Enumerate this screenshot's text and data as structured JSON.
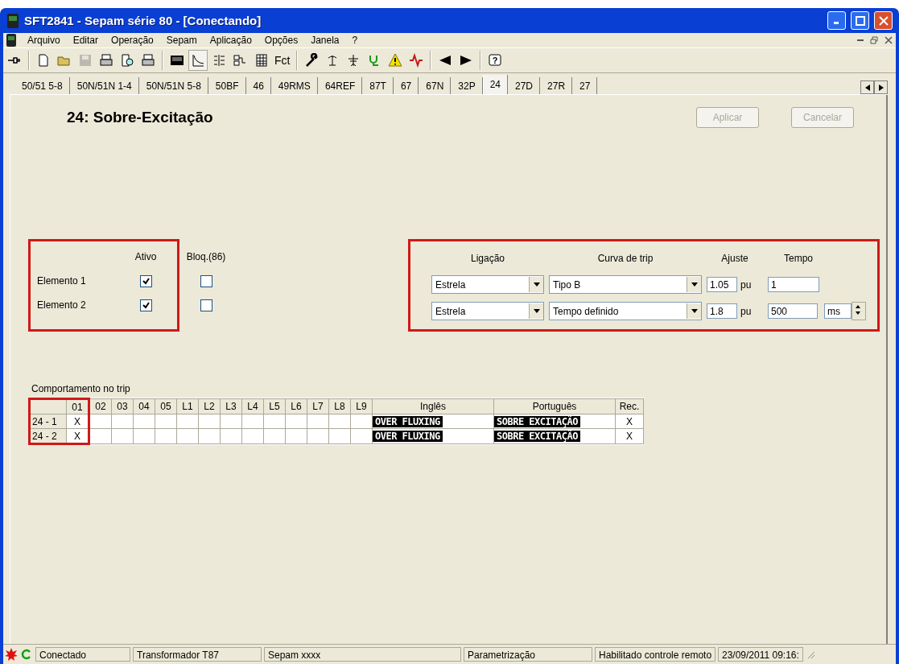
{
  "window": {
    "title": "SFT2841 - Sepam série 80 - [Conectando]"
  },
  "menu": [
    "Arquivo",
    "Editar",
    "Operação",
    "Sepam",
    "Aplicação",
    "Opções",
    "Janela",
    "?"
  ],
  "toolbar": [
    {
      "kind": "plug",
      "disabled": false,
      "selected": false
    },
    {
      "kind": "sep"
    },
    {
      "kind": "new",
      "disabled": false,
      "selected": false
    },
    {
      "kind": "open",
      "disabled": false,
      "selected": false
    },
    {
      "kind": "save",
      "disabled": true,
      "selected": false
    },
    {
      "kind": "print",
      "disabled": false,
      "selected": false
    },
    {
      "kind": "preview",
      "disabled": false,
      "selected": false
    },
    {
      "kind": "print",
      "disabled": false,
      "selected": false
    },
    {
      "kind": "sep"
    },
    {
      "kind": "device",
      "disabled": false,
      "selected": false
    },
    {
      "kind": "curve",
      "disabled": false,
      "selected": true
    },
    {
      "kind": "matrix",
      "disabled": false,
      "selected": false
    },
    {
      "kind": "logic",
      "disabled": false,
      "selected": false
    },
    {
      "kind": "table",
      "disabled": false,
      "selected": false
    },
    {
      "kind": "text",
      "label": "Fct",
      "disabled": false,
      "selected": false
    },
    {
      "kind": "sep"
    },
    {
      "kind": "wrench",
      "disabled": false,
      "selected": false
    },
    {
      "kind": "antenna",
      "disabled": false,
      "selected": false
    },
    {
      "kind": "circuit",
      "disabled": false,
      "selected": false
    },
    {
      "kind": "stethoscope",
      "disabled": false,
      "selected": false
    },
    {
      "kind": "warning",
      "disabled": false,
      "selected": false
    },
    {
      "kind": "wave",
      "disabled": false,
      "selected": false
    },
    {
      "kind": "sep"
    },
    {
      "kind": "back",
      "disabled": false,
      "selected": false
    },
    {
      "kind": "forward",
      "disabled": false,
      "selected": false
    },
    {
      "kind": "sep"
    },
    {
      "kind": "help",
      "label": "?",
      "disabled": false,
      "selected": false
    }
  ],
  "tabs": [
    {
      "label": "50/51 5-8",
      "selected": false
    },
    {
      "label": "50N/51N 1-4",
      "selected": false
    },
    {
      "label": "50N/51N 5-8",
      "selected": false
    },
    {
      "label": "50BF",
      "selected": false
    },
    {
      "label": "46",
      "selected": false
    },
    {
      "label": "49RMS",
      "selected": false
    },
    {
      "label": "64REF",
      "selected": false
    },
    {
      "label": "87T",
      "selected": false
    },
    {
      "label": "67",
      "selected": false
    },
    {
      "label": "67N",
      "selected": false
    },
    {
      "label": "32P",
      "selected": false
    },
    {
      "label": "24",
      "selected": true
    },
    {
      "label": "27D",
      "selected": false
    },
    {
      "label": "27R",
      "selected": false
    },
    {
      "label": "27",
      "selected": false
    }
  ],
  "page": {
    "title": "24: Sobre-Excitação",
    "buttons": [
      {
        "label": "Aplicar",
        "disabled": true
      },
      {
        "label": "Cancelar",
        "disabled": true
      }
    ]
  },
  "elements": {
    "headers": [
      "Ativo",
      "Bloq.(86)"
    ],
    "rows": [
      {
        "label": "Elemento 1",
        "active": true,
        "blocked": false
      },
      {
        "label": "Elemento 2",
        "active": true,
        "blocked": false
      }
    ]
  },
  "settings": {
    "headers": [
      "Ligação",
      "Curva de trip",
      "Ajuste",
      "Tempo"
    ],
    "rows": [
      {
        "connection": "Estrela",
        "curve": "Tipo B",
        "setting": "1.05",
        "unit": "pu",
        "time": "1"
      },
      {
        "connection": "Estrela",
        "curve": "Tempo definido",
        "setting": "1.8",
        "unit": "pu",
        "time": "500",
        "time_unit": "ms"
      }
    ]
  },
  "trip": {
    "title": "Comportamento no trip",
    "outputs": [
      "01",
      "02",
      "03",
      "04",
      "05",
      "L1",
      "L2",
      "L3",
      "L4",
      "L5",
      "L6",
      "L7",
      "L8",
      "L9"
    ],
    "english": "Inglês",
    "portuguese": "Português",
    "rec": "Rec.",
    "rows": [
      {
        "label": "24 - 1",
        "marks": [
          "X"
        ],
        "english": "OVER FLUXING",
        "portuguese": "SOBRE EXCITAÇÃO",
        "rec": "X"
      },
      {
        "label": "24 - 2",
        "marks": [
          "X"
        ],
        "english": "OVER FLUXING",
        "portuguese": "SOBRE EXCITAÇÃO",
        "rec": "X"
      }
    ]
  },
  "status_bar": [
    "Conectado",
    "Transformador T87",
    "Sepam xxxx",
    "Parametrização",
    "Habilitado controle remoto",
    "23/09/2011  09:16:"
  ]
}
